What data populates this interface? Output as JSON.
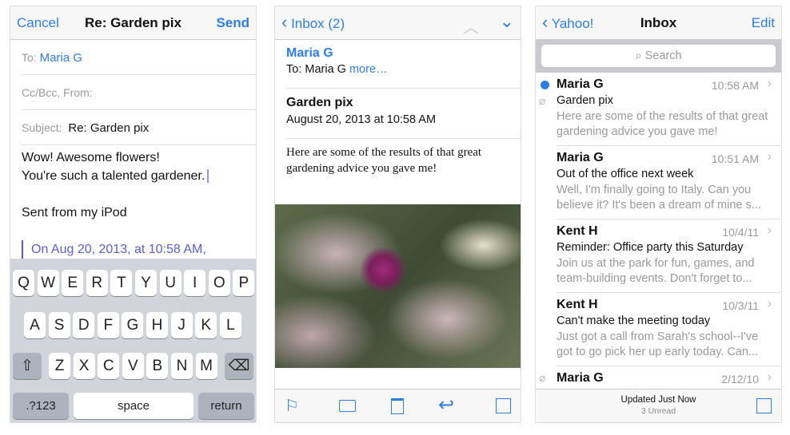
{
  "compose": {
    "cancel": "Cancel",
    "title": "Re: Garden pix",
    "send": "Send",
    "to_label": "To:",
    "to_value": "Maria G",
    "ccbcc": "Cc/Bcc, From:",
    "subject_label": "Subject:",
    "subject_value": "Re: Garden pix",
    "body_line1": "Wow! Awesome flowers!",
    "body_line2": "You're such a talented gardener.",
    "signature": "Sent from my iPod",
    "quote": "On Aug 20, 2013, at 10:58 AM,",
    "keyboard": {
      "row1": [
        "Q",
        "W",
        "E",
        "R",
        "T",
        "Y",
        "U",
        "I",
        "O",
        "P"
      ],
      "row2": [
        "A",
        "S",
        "D",
        "F",
        "G",
        "H",
        "J",
        "K",
        "L"
      ],
      "row3": [
        "Z",
        "X",
        "C",
        "V",
        "B",
        "N",
        "M"
      ],
      "numbers": ".?123",
      "space": "space",
      "return": "return"
    }
  },
  "message": {
    "back": "Inbox (2)",
    "from": "Maria G",
    "to_label": "To: Maria G",
    "more": "more…",
    "subject": "Garden pix",
    "date": "August 20, 2013 at 10:58 AM",
    "body": "Here are some of the results of that great gardening advice you gave me!"
  },
  "inbox": {
    "back": "Yahoo!",
    "title": "Inbox",
    "edit": "Edit",
    "search_placeholder": "Search",
    "status": "Updated Just Now",
    "unread": "3 Unread",
    "accent": "#2f7ddf",
    "messages": [
      {
        "from": "Maria G",
        "time": "10:58 AM",
        "subject": "Garden pix",
        "preview": "Here are some of the results of that great gardening advice you gave me!",
        "unread": true,
        "attachment": true
      },
      {
        "from": "Maria G",
        "time": "10:51 AM",
        "subject": "Out of the office next week",
        "preview": "Well, I'm finally going to Italy. Can you believe it? It's been a dream of mine s..."
      },
      {
        "from": "Kent H",
        "time": "10/4/11",
        "subject": "Reminder: Office party this Saturday",
        "preview": "Join us at the park for fun, games, and team-building events. Don't forget to..."
      },
      {
        "from": "Kent H",
        "time": "10/3/11",
        "subject": "Can't make the meeting today",
        "preview": "Just got a call from Sarah's school--I've got to go pick her up early today. Can..."
      },
      {
        "from": "Maria G",
        "time": "2/12/10",
        "attachment": true
      }
    ]
  }
}
